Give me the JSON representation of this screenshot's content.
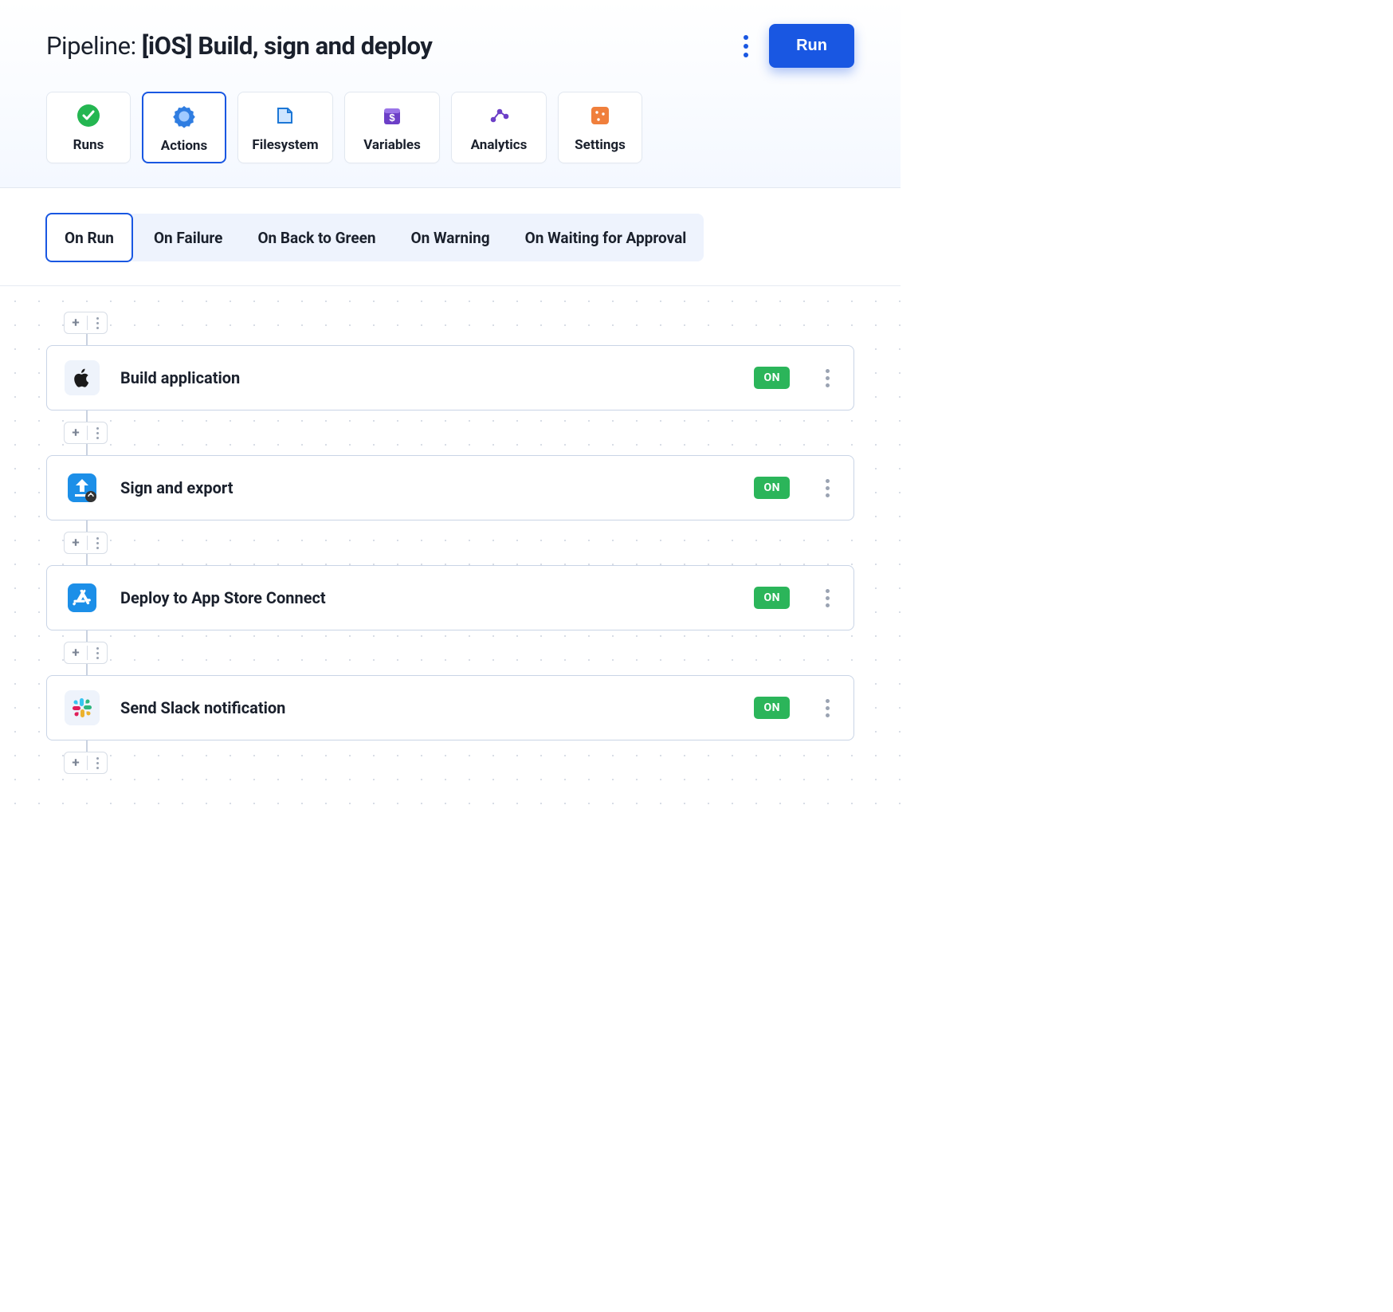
{
  "header": {
    "title_prefix": "Pipeline: ",
    "title_main": "[iOS] Build, sign and deploy",
    "run_button": "Run"
  },
  "nav": {
    "runs": "Runs",
    "actions": "Actions",
    "filesystem": "Filesystem",
    "variables": "Variables",
    "analytics": "Analytics",
    "settings": "Settings"
  },
  "subtabs": {
    "on_run": "On Run",
    "on_failure": "On Failure",
    "on_back": "On Back to Green",
    "on_warning": "On Warning",
    "on_waiting": "On Waiting for Approval"
  },
  "actions": {
    "status_on": "ON",
    "items": [
      {
        "label": "Build application"
      },
      {
        "label": "Sign and export"
      },
      {
        "label": "Deploy to App Store Connect"
      },
      {
        "label": "Send Slack notification"
      }
    ]
  }
}
